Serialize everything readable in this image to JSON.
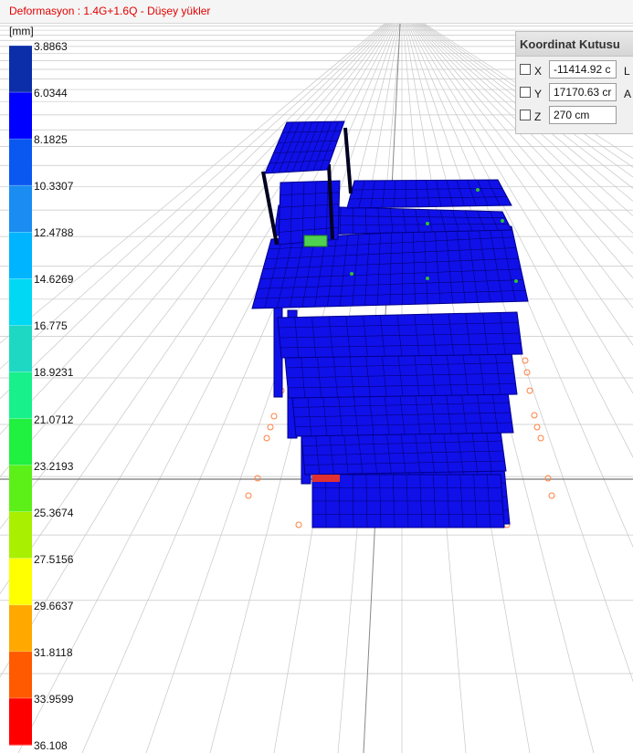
{
  "viewport": {
    "title": "Deformasyon : 1.4G+1.6Q  -  Düşey yükler",
    "title_color": "#e00000",
    "model_color": "#1010e8"
  },
  "legend": {
    "unit": "[mm]",
    "values": [
      "3.8863",
      "6.0344",
      "8.1825",
      "10.3307",
      "12.4788",
      "14.6269",
      "16.775",
      "18.9231",
      "21.0712",
      "23.2193",
      "25.3674",
      "27.5156",
      "29.6637",
      "31.8118",
      "33.9599",
      "36.108"
    ],
    "colors": [
      "#0c2ea8",
      "#0000ff",
      "#0a58f0",
      "#1a8cf2",
      "#00b4ff",
      "#00d8f4",
      "#1ed8c4",
      "#18f08c",
      "#20f040",
      "#5cf018",
      "#a8f000",
      "#ffff00",
      "#ffa800",
      "#ff5a00",
      "#ff0000",
      "#e0105c"
    ]
  },
  "coord_box": {
    "title": "Koordinat Kutusu",
    "rows": [
      {
        "axis": "X",
        "value": "-11414.92 c",
        "side": "L"
      },
      {
        "axis": "Y",
        "value": "17170.63 cr",
        "side": "A"
      },
      {
        "axis": "Z",
        "value": "270 cm",
        "side": ""
      }
    ]
  }
}
